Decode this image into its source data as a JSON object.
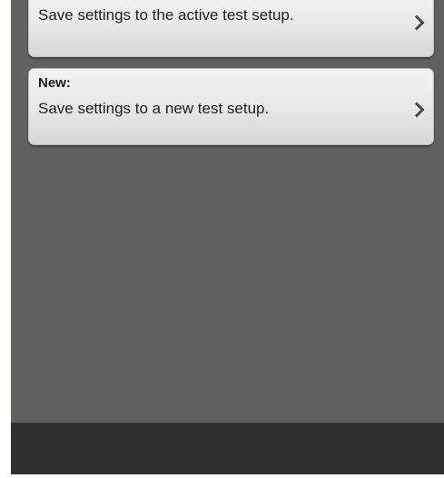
{
  "options": {
    "active": {
      "title": "",
      "description": "Save settings to the active test setup.",
      "icon": "chevron-right-icon"
    },
    "new": {
      "title": "New:",
      "description": "Save settings to a new test setup.",
      "icon": "chevron-right-icon"
    }
  },
  "colors": {
    "screen_background": "#60625e",
    "bottom_bar": "#2f2f2f",
    "card_background": "#e7e7e5"
  }
}
